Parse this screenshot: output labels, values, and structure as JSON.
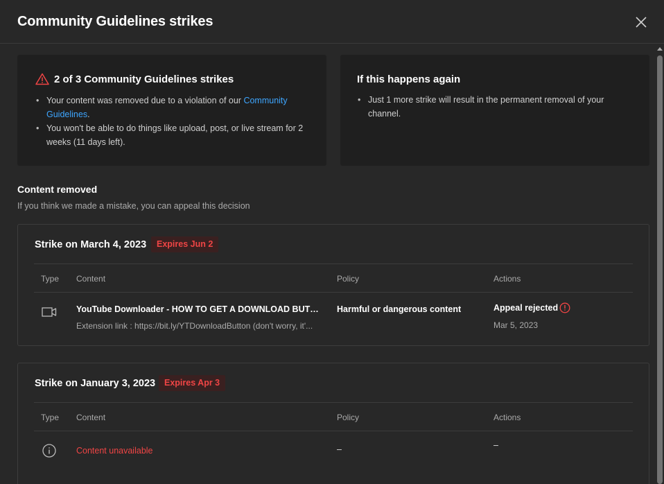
{
  "dialog": {
    "title": "Community Guidelines strikes"
  },
  "status_card": {
    "heading": "2 of 3 Community Guidelines strikes",
    "bullet1_prefix": "Your content was removed due to a violation of our ",
    "bullet1_link": "Community Guidelines",
    "bullet1_suffix": ".",
    "bullet2": "You won't be able to do things like upload, post, or live stream for 2 weeks (11 days left)."
  },
  "warning_card": {
    "heading": "If this happens again",
    "bullet1": "Just 1 more strike will result in the permanent removal of your channel."
  },
  "content_removed": {
    "title": "Content removed",
    "subtitle": "If you think we made a mistake, you can appeal this decision"
  },
  "table_headers": {
    "type": "Type",
    "content": "Content",
    "policy": "Policy",
    "actions": "Actions"
  },
  "strikes": [
    {
      "title": "Strike on March 4, 2023",
      "expires": "Expires Jun 2",
      "row": {
        "type_icon": "video-icon",
        "content_title": "YouTube Downloader - HOW TO GET A DOWNLOAD BUTTO...",
        "content_desc": "Extension link : https://bit.ly/YTDownloadButton (don't worry, it'...",
        "policy": "Harmful or dangerous content",
        "action": "Appeal rejected",
        "action_date": "Mar 5, 2023"
      }
    },
    {
      "title": "Strike on January 3, 2023",
      "expires": "Expires Apr 3",
      "row": {
        "type_icon": "info-icon",
        "content_title": "Content unavailable",
        "policy": "–",
        "action": "–"
      }
    }
  ],
  "colors": {
    "background": "#282828",
    "card": "#1f1f1f",
    "link": "#3ea6ff",
    "danger": "#f04545",
    "muted_text": "#aaaaaa"
  }
}
